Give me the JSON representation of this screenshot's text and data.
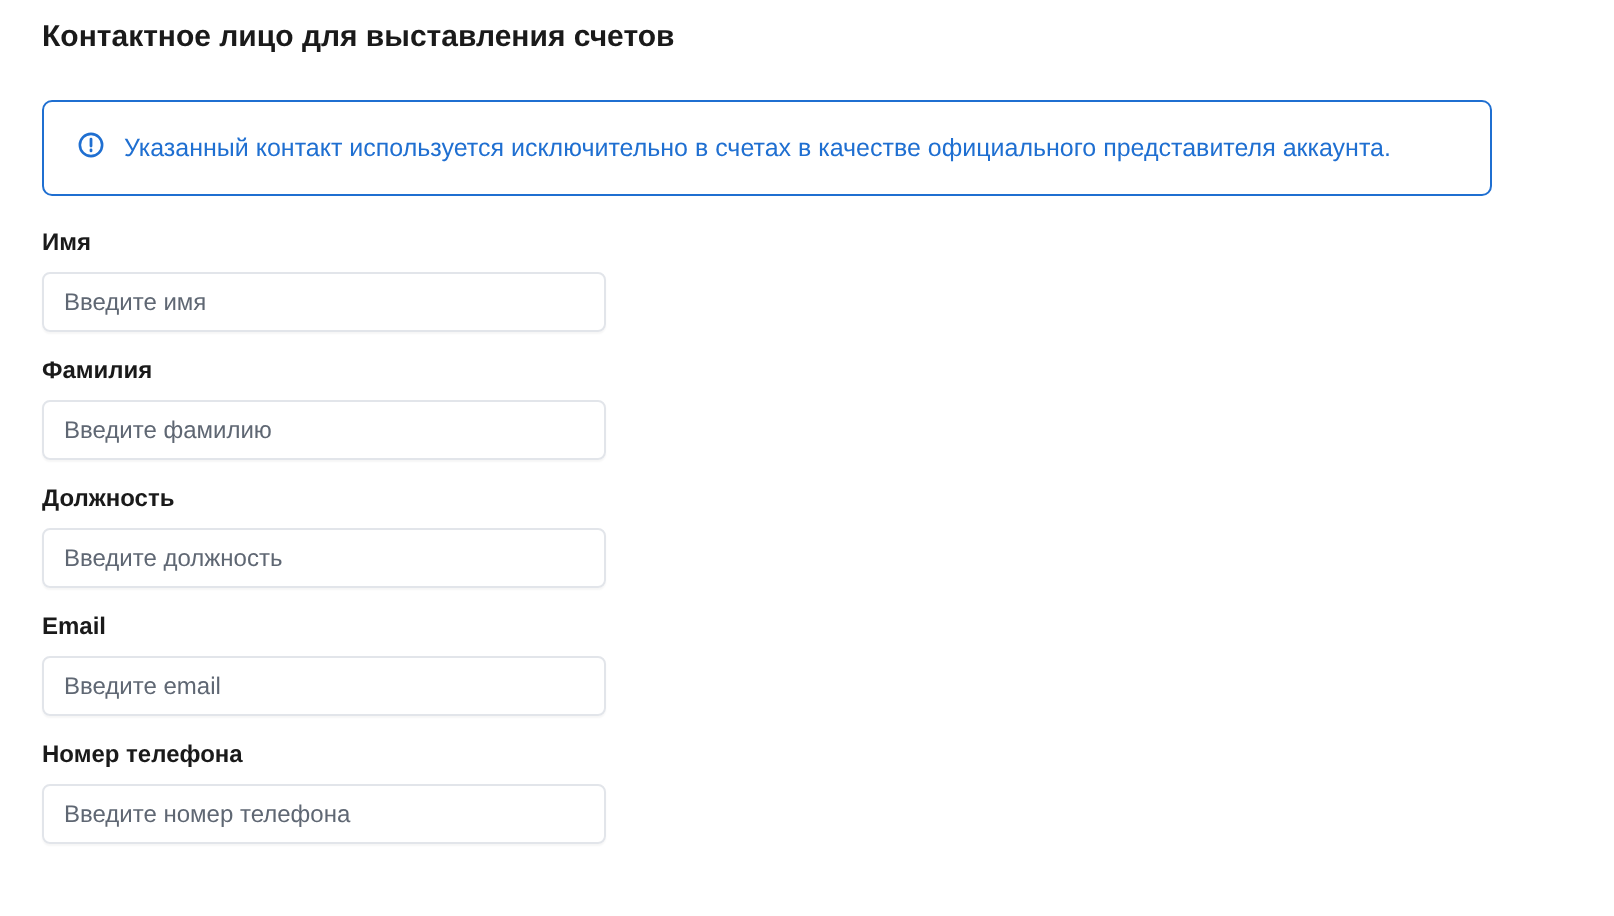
{
  "title": "Контактное лицо для выставления счетов",
  "notice": {
    "text": "Указанный контакт используется исключительно в счетах в качестве официального представителя аккаунта."
  },
  "fields": [
    {
      "label": "Имя",
      "placeholder": "Введите имя"
    },
    {
      "label": "Фамилия",
      "placeholder": "Введите фамилию"
    },
    {
      "label": "Должность",
      "placeholder": "Введите должность"
    },
    {
      "label": "Email",
      "placeholder": "Введите email"
    },
    {
      "label": "Номер телефона",
      "placeholder": "Введите номер телефона"
    }
  ]
}
